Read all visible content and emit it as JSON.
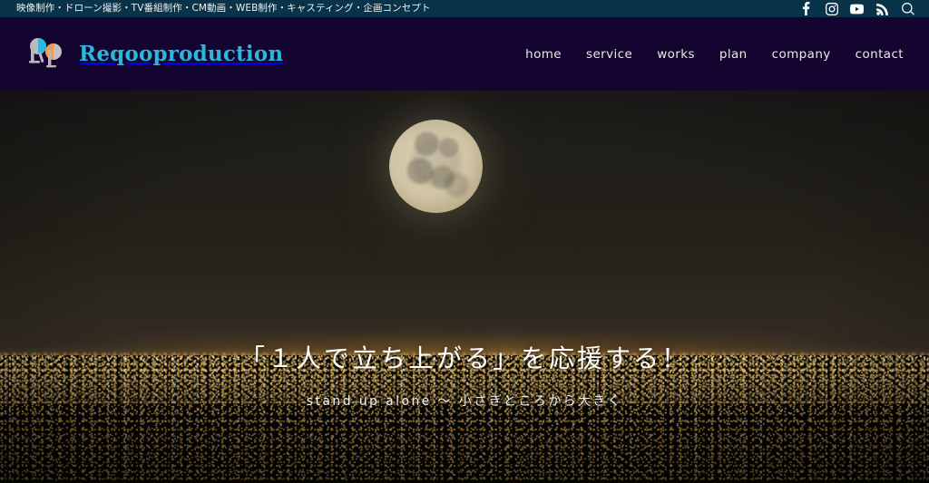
{
  "topbar": {
    "tagline": "映像制作・ドローン撮影・TV番組制作・CM動画・WEB制作・キャスティング・企画コンセプト",
    "social": [
      {
        "name": "facebook-icon",
        "label": "Facebook"
      },
      {
        "name": "instagram-icon",
        "label": "Instagram"
      },
      {
        "name": "youtube-icon",
        "label": "YouTube"
      },
      {
        "name": "rss-icon",
        "label": "RSS"
      },
      {
        "name": "search-icon",
        "label": "Search"
      }
    ],
    "background_color": "#083348",
    "text_color": "#f0f2f3"
  },
  "header": {
    "brand_name": "Reqooproduction",
    "brand_color": "#29b7da",
    "background_color": "#130530",
    "logo_colors": {
      "letterform": "#b9b7bd",
      "circle_left": "#2bb9dd",
      "circle_right": "#f29a4e",
      "circle_gray": "#c3c1c6"
    },
    "nav": [
      {
        "label": "home"
      },
      {
        "label": "service"
      },
      {
        "label": "works"
      },
      {
        "label": "plan"
      },
      {
        "label": "company"
      },
      {
        "label": "contact"
      }
    ],
    "nav_color": "#ece8e4"
  },
  "hero": {
    "title": "「１人で立ち上がる」を応援する！",
    "subtitle": "stand up alone 〜 小さきところから大きく",
    "title_color": "#ffffff",
    "subtitle_color": "#f2f1ef",
    "scene": {
      "moon": "full-moon",
      "background": "night-city-skyline-aerial",
      "sky_top_color": "#1d1c1a",
      "horizon_glow_color": "#ffc454",
      "city_light_color": "#ffbe4a"
    }
  }
}
